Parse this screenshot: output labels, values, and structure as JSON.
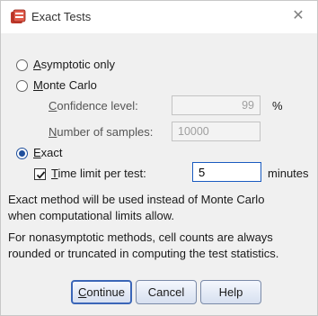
{
  "window": {
    "title": "Exact Tests",
    "close_glyph": "✕"
  },
  "options": {
    "asymptotic": {
      "label": "Asymptotic only",
      "underline": "A",
      "rest": "symptotic only",
      "checked": false
    },
    "monte_carlo": {
      "label": "Monte Carlo",
      "underline": "M",
      "rest": "onte Carlo",
      "checked": false,
      "confidence": {
        "underline": "C",
        "rest": "onfidence level:",
        "value": "99",
        "unit": "%"
      },
      "samples": {
        "underline": "N",
        "rest": "umber of samples:",
        "value": "10000"
      }
    },
    "exact": {
      "label": "Exact",
      "underline": "E",
      "rest": "xact",
      "checked": true,
      "time_limit": {
        "underline": "T",
        "rest": "ime limit per test:",
        "checked": true,
        "value": "5",
        "unit": "minutes"
      }
    }
  },
  "notes": {
    "line1": "Exact method will be used instead of Monte Carlo",
    "line2": "when computational limits allow.",
    "line3": "For nonasymptotic methods, cell counts are always",
    "line4": "rounded or truncated in computing the test statistics."
  },
  "buttons": {
    "continue": {
      "underline": "C",
      "rest": "ontinue"
    },
    "cancel": "Cancel",
    "help": "Help"
  },
  "colors": {
    "accent": "#1f4f9c",
    "focus_border": "#1a5bc0"
  }
}
